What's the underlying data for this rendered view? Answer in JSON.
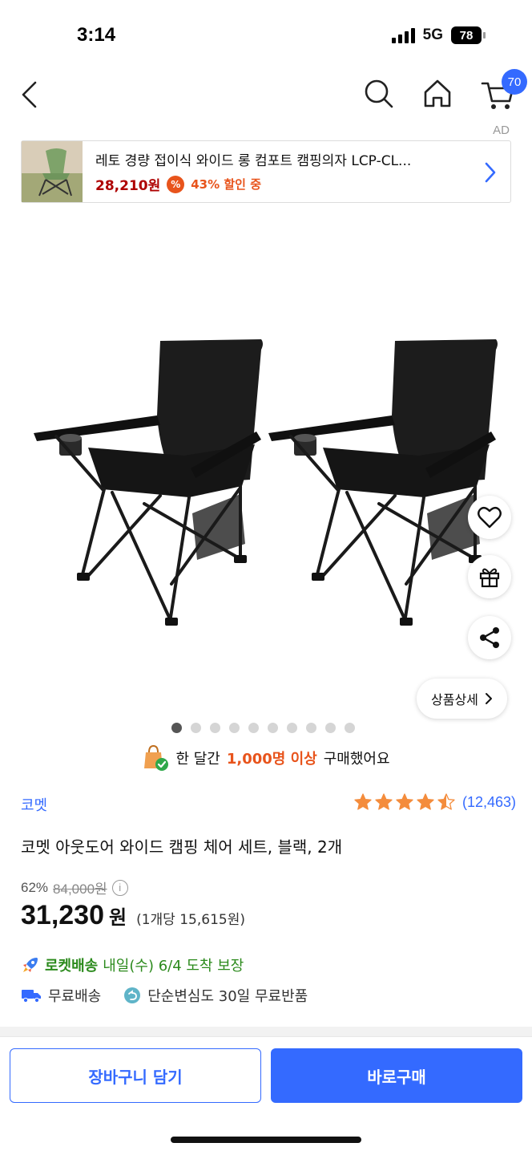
{
  "status_bar": {
    "time": "3:14",
    "network": "5G",
    "battery": "78"
  },
  "nav": {
    "cart_count": "70",
    "ad_label": "AD"
  },
  "ad_banner": {
    "title": "레토 경량 접이식 와이드 롱 컴포트 캠핑의자 LCP-CL...",
    "price": "28,210원",
    "pct_icon": "%",
    "discount": "43% 할인 중"
  },
  "image": {
    "dot_count": 10,
    "active_dot": 0,
    "detail_button": "상품상세"
  },
  "social_proof": {
    "prefix": "한 달간",
    "highlight": "1,000명 이상",
    "suffix": "구매했어요"
  },
  "product": {
    "brand": "코멧",
    "rating": 4.5,
    "review_count": "(12,463)",
    "title": "코멧 아웃도어 와이드 캠핑 체어 세트, 블랙, 2개",
    "discount_pct": "62%",
    "original_price": "84,000원",
    "price": "31,230",
    "price_unit": "원",
    "unit_price": "(1개당 15,615원)"
  },
  "delivery": {
    "rocket_label": "로켓배송",
    "rocket_text": "내일(수) 6/4 도착 보장",
    "free_shipping": "무료배송",
    "free_return": "단순변심도 30일 무료반품"
  },
  "buttons": {
    "cart": "장바구니 담기",
    "buy": "바로구매"
  },
  "colors": {
    "accent": "#346aff",
    "price_red": "#ae0000",
    "orange": "#e8541c",
    "rocket_green": "#2b8a1c"
  }
}
